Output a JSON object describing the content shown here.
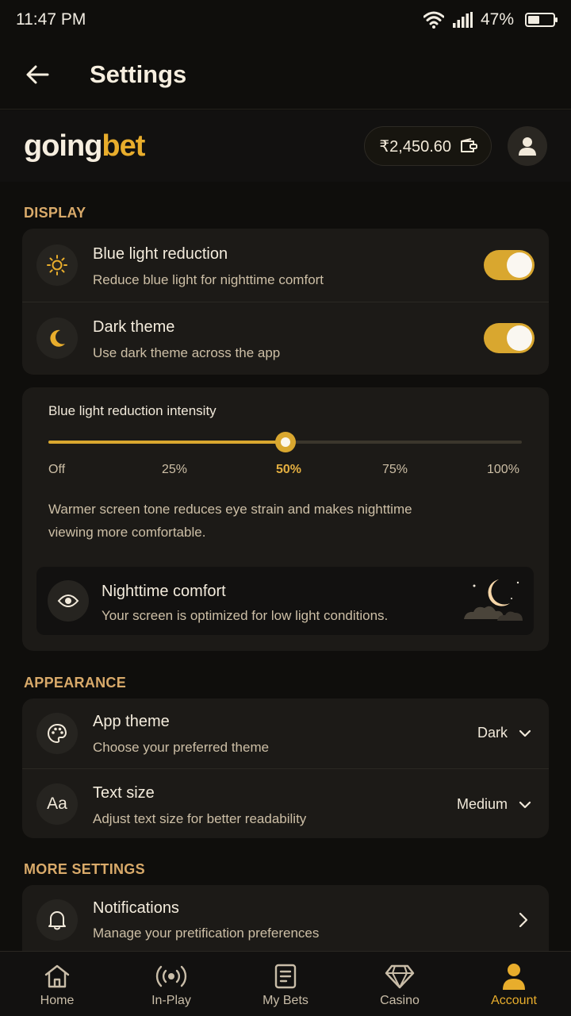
{
  "status_bar": {
    "time": "11:47 PM",
    "battery": "47%",
    "battery_level": 0.47
  },
  "app_bar": {
    "title": "Settings"
  },
  "brand": {
    "logo_part1": "going",
    "logo_part2": "bet",
    "balance": "₹2,450.60"
  },
  "display": {
    "section_title": "DISPLAY",
    "items": [
      {
        "title": "Blue light reduction",
        "subtitle": "Reduce blue light for nighttime comfort",
        "icon": "sun-icon",
        "enabled": true
      },
      {
        "title": "Dark theme",
        "subtitle": "Use dark theme across the app",
        "icon": "moon-icon",
        "enabled": true
      }
    ]
  },
  "intensity": {
    "label": "Blue light reduction intensity",
    "value_percent": 50,
    "ticks": [
      "Off",
      "25%",
      "50%",
      "75%",
      "100%"
    ],
    "active_tick": "50%",
    "description": "Warmer screen tone reduces eye strain and makes nighttime viewing more comfortable.",
    "comfort": {
      "title": "Nighttime comfort",
      "subtitle": "Your screen is optimized for low light conditions.",
      "icon": "eye-icon"
    }
  },
  "appearance": {
    "section_title": "APPEARANCE",
    "items": [
      {
        "title": "App theme",
        "subtitle": "Choose your preferred theme",
        "value": "Dark",
        "icon": "palette-icon"
      },
      {
        "title": "Text size",
        "subtitle": "Adjust text size for better readability",
        "value": "Medium",
        "icon": "text-size-icon",
        "icon_text": "Aa"
      }
    ]
  },
  "more_settings": {
    "section_title": "MORE SETTINGS",
    "items": [
      {
        "title": "Notifications",
        "subtitle": "Manage your pretification preferences",
        "icon": "bell-icon"
      }
    ]
  },
  "bottom_nav": {
    "items": [
      {
        "label": "Home",
        "icon": "home-icon"
      },
      {
        "label": "In-Play",
        "icon": "broadcast-icon"
      },
      {
        "label": "My Bets",
        "icon": "receipt-icon"
      },
      {
        "label": "Casino",
        "icon": "diamond-icon"
      },
      {
        "label": "Account",
        "icon": "user-icon",
        "active": true
      }
    ]
  },
  "colors": {
    "accent": "#e8ad2c",
    "background": "#0f0e0c",
    "card": "#1c1a17",
    "section_title": "#d9aa6a"
  }
}
